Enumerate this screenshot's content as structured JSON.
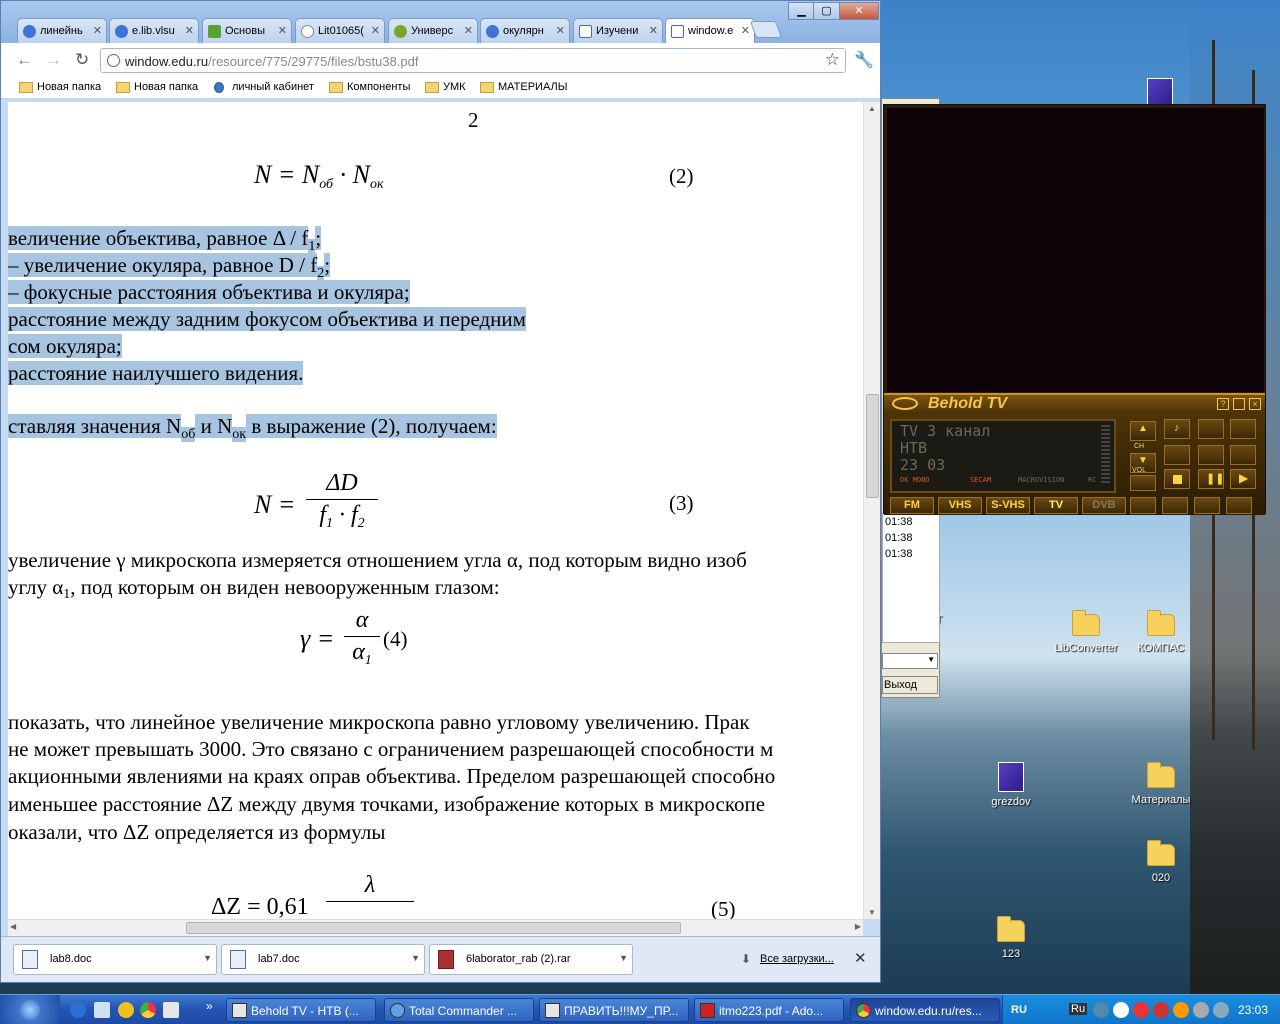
{
  "browser": {
    "tabs": [
      {
        "label": "линейнь",
        "color": "#e3402c"
      },
      {
        "label": "e.lib.vlsu",
        "color": "#3b73d6"
      },
      {
        "label": "Основы",
        "color": "#58a23c"
      },
      {
        "label": "Lit01065(",
        "color": "#7a8ca0"
      },
      {
        "label": "Универс",
        "color": "#76a82e"
      },
      {
        "label": "окулярн",
        "color": "#e3402c"
      },
      {
        "label": "Изучени",
        "color": "#4a68b8"
      },
      {
        "label": "window.e",
        "color": "#4a68b8"
      }
    ],
    "url_host": "window.edu.ru",
    "url_path": "/resource/775/29775/files/bstu38.pdf",
    "bookmarks": [
      "Новая папка",
      "Новая папка",
      "личный кабинет",
      "Компоненты",
      "УМК",
      "МАТЕРИАЛЫ"
    ],
    "downloads": [
      "lab8.doc",
      "lab7.doc",
      "6laborator_rab (2).rar"
    ],
    "all_downloads": "Все загрузки...",
    "close_glyph": "✕"
  },
  "document": {
    "page_number": "2",
    "eq2_number": "(2)",
    "eq3_number": "(3)",
    "eq4_number": "(4)",
    "eq5_number": "(5)",
    "lines_highlighted": [
      "величение объектива, равное Δ / f",
      "–  увеличение окуляра, равное  D / f",
      "–  фокусные расстояния объектива и окуляра;",
      " расстояние между задним фокусом объектива и передним",
      "сом окуляра;",
      "расстояние наилучшего видения.",
      "ставляя значения  N"
    ],
    "line6_mid": "и N",
    "line6_end": "в выражение (2), получаем:",
    "sub_ob": "об",
    "sub_ok": "ок",
    "sub_1": "1",
    "sub_2": "2",
    "semicolon": ";",
    "para1_line1": " увеличение γ микроскопа измеряется отношением угла α, под которым видно изоб",
    "para1_line2": " углу α",
    "para1_line2b": ", под которым  он виден невооруженным глазом:",
    "para2": [
      "показать, что линейное увеличение микроскопа равно угловому увеличению. Прак",
      "не может превышать 3000. Это связано с ограничением разрешающей способности м",
      "акционными явлениями на краях оправ объектива. Пределом разрешающей способно",
      "именьшее расстояние ΔZ между двумя точками, изображение которых в микроскопе",
      "оказали, что ΔZ определяется из формулы"
    ],
    "eq5_lhs": "ΔZ = 0,61",
    "eq5_num": "λ"
  },
  "behold": {
    "title": "Behold TV",
    "lcd_line1": "TV 3 канал",
    "lcd_line2": "НТВ",
    "lcd_line3": "23 03",
    "lcd_small": [
      "DK MONO",
      "SECAM",
      "MACROVISION",
      "RC"
    ],
    "buttons": [
      "FM",
      "VHS",
      "S-VHS",
      "TV",
      "DVB"
    ],
    "side_labels": [
      "CH",
      "VOL"
    ]
  },
  "tc": {
    "times": [
      "01:38",
      "01:38",
      "01:38"
    ],
    "exit": "Выход"
  },
  "desktop_icons": [
    "LibConverter",
    "КОМПАС",
    "grezdov",
    "Материалы",
    "020",
    "123",
    "CT"
  ],
  "taskbar": {
    "tasks": [
      "Behold TV - НТВ (...",
      "Total Commander ...",
      "ПРАВИТЬ!!!МУ_ПР...",
      "itmo223.pdf - Ado...",
      "window.edu.ru/res..."
    ],
    "lang": "RU",
    "lang2": "Ru",
    "clock": "23:03",
    "more": "»"
  }
}
